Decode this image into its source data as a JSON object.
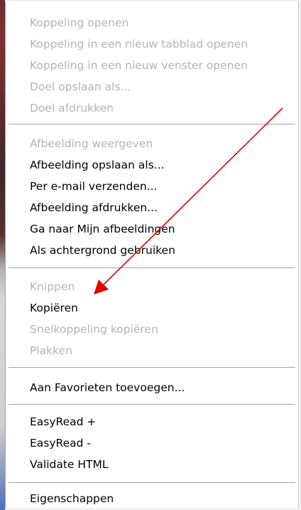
{
  "context_menu": {
    "group1": [
      {
        "label": "Koppeling openen",
        "enabled": false
      },
      {
        "label": "Koppeling in een nieuw tabblad openen",
        "enabled": false
      },
      {
        "label": "Koppeling in een nieuw venster openen",
        "enabled": false
      },
      {
        "label": "Doel opslaan als...",
        "enabled": false
      },
      {
        "label": "Doel afdrukken",
        "enabled": false
      }
    ],
    "group2": [
      {
        "label": "Afbeelding weergeven",
        "enabled": false
      },
      {
        "label": "Afbeelding opslaan als...",
        "enabled": true
      },
      {
        "label": "Per e-mail verzenden...",
        "enabled": true
      },
      {
        "label": "Afbeelding afdrukken...",
        "enabled": true
      },
      {
        "label": "Ga naar Mijn afbeeldingen",
        "enabled": true
      },
      {
        "label": "Als achtergrond gebruiken",
        "enabled": true
      }
    ],
    "group3": [
      {
        "label": "Knippen",
        "enabled": false
      },
      {
        "label": "Kopiëren",
        "enabled": true
      },
      {
        "label": "Snelkoppeling kopiëren",
        "enabled": false
      },
      {
        "label": "Plakken",
        "enabled": false
      }
    ],
    "group4": [
      {
        "label": "Aan Favorieten toevoegen...",
        "enabled": true
      }
    ],
    "group5": [
      {
        "label": "EasyRead +",
        "enabled": true
      },
      {
        "label": "EasyRead -",
        "enabled": true
      },
      {
        "label": "Validate HTML",
        "enabled": true
      }
    ],
    "group6": [
      {
        "label": "Eigenschappen",
        "enabled": true
      }
    ]
  },
  "colors": {
    "text_enabled": "#000000",
    "text_disabled": "#b4b4b4",
    "menu_background": "#ffffff",
    "annotation_arrow": "#e00000"
  },
  "annotation": {
    "type": "arrow",
    "points_to": "Kopiëren"
  }
}
